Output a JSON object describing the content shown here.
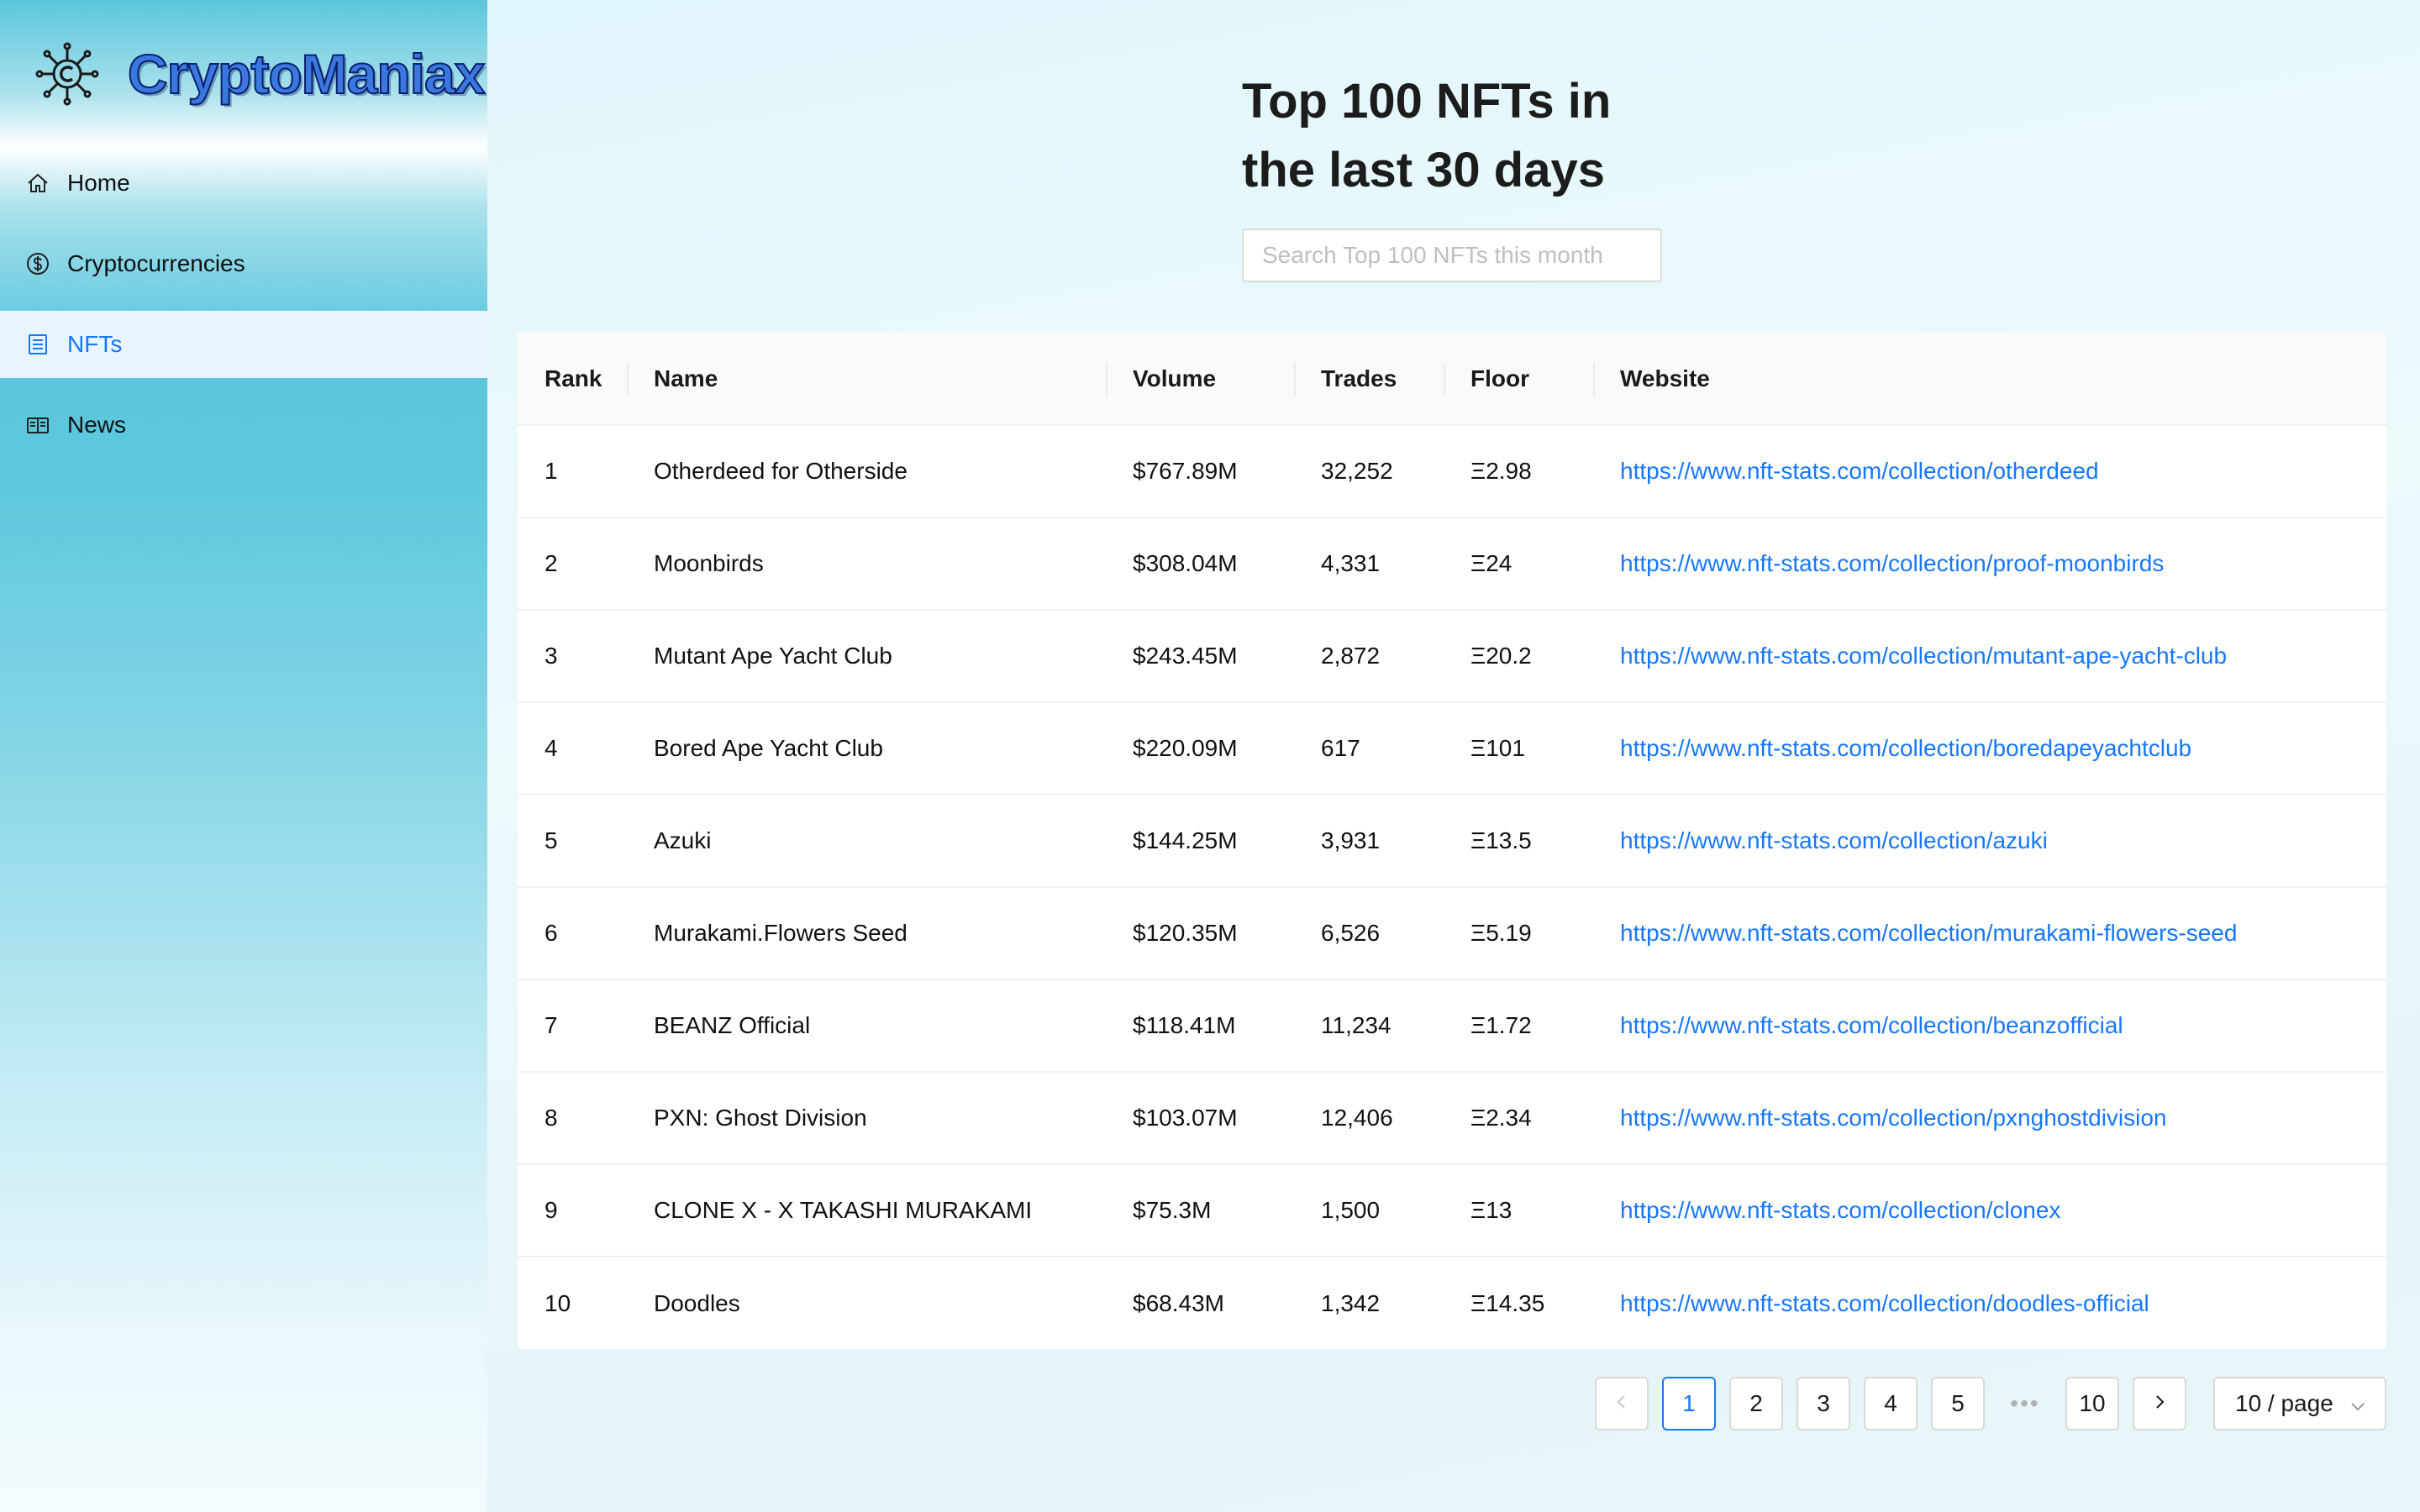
{
  "brand": {
    "name": "CryptoManiax",
    "logo_icon": "crypto-network-icon"
  },
  "sidebar": {
    "items": [
      {
        "label": "Home",
        "icon": "home-icon",
        "active": false
      },
      {
        "label": "Cryptocurrencies",
        "icon": "dollar-circle-icon",
        "active": false
      },
      {
        "label": "NFTs",
        "icon": "list-icon",
        "active": true
      },
      {
        "label": "News",
        "icon": "book-icon",
        "active": false
      }
    ]
  },
  "main": {
    "title_line1": "Top 100 NFTs in",
    "title_line2": "the last 30 days",
    "search_placeholder": "Search Top 100 NFTs this month",
    "search_value": ""
  },
  "table": {
    "columns": [
      "Rank",
      "Name",
      "Volume",
      "Trades",
      "Floor",
      "Website"
    ],
    "rows": [
      {
        "rank": "1",
        "name": "Otherdeed for Otherside",
        "volume": "$767.89M",
        "trades": "32,252",
        "floor": "Ξ2.98",
        "website": "https://www.nft-stats.com/collection/otherdeed"
      },
      {
        "rank": "2",
        "name": "Moonbirds",
        "volume": "$308.04M",
        "trades": "4,331",
        "floor": "Ξ24",
        "website": "https://www.nft-stats.com/collection/proof-moonbirds"
      },
      {
        "rank": "3",
        "name": "Mutant Ape Yacht Club",
        "volume": "$243.45M",
        "trades": "2,872",
        "floor": "Ξ20.2",
        "website": "https://www.nft-stats.com/collection/mutant-ape-yacht-club"
      },
      {
        "rank": "4",
        "name": "Bored Ape Yacht Club",
        "volume": "$220.09M",
        "trades": "617",
        "floor": "Ξ101",
        "website": "https://www.nft-stats.com/collection/boredapeyachtclub"
      },
      {
        "rank": "5",
        "name": "Azuki",
        "volume": "$144.25M",
        "trades": "3,931",
        "floor": "Ξ13.5",
        "website": "https://www.nft-stats.com/collection/azuki"
      },
      {
        "rank": "6",
        "name": "Murakami.Flowers Seed",
        "volume": "$120.35M",
        "trades": "6,526",
        "floor": "Ξ5.19",
        "website": "https://www.nft-stats.com/collection/murakami-flowers-seed"
      },
      {
        "rank": "7",
        "name": "BEANZ Official",
        "volume": "$118.41M",
        "trades": "11,234",
        "floor": "Ξ1.72",
        "website": "https://www.nft-stats.com/collection/beanzofficial"
      },
      {
        "rank": "8",
        "name": "PXN: Ghost Division",
        "volume": "$103.07M",
        "trades": "12,406",
        "floor": "Ξ2.34",
        "website": "https://www.nft-stats.com/collection/pxnghostdivision"
      },
      {
        "rank": "9",
        "name": "CLONE X - X TAKASHI MURAKAMI",
        "volume": "$75.3M",
        "trades": "1,500",
        "floor": "Ξ13",
        "website": "https://www.nft-stats.com/collection/clonex"
      },
      {
        "rank": "10",
        "name": "Doodles",
        "volume": "$68.43M",
        "trades": "1,342",
        "floor": "Ξ14.35",
        "website": "https://www.nft-stats.com/collection/doodles-official"
      }
    ]
  },
  "pagination": {
    "prev_icon": "chevron-left-icon",
    "next_icon": "chevron-right-icon",
    "pages": [
      "1",
      "2",
      "3",
      "4",
      "5"
    ],
    "ellipsis": "•••",
    "last_page": "10",
    "current": "1",
    "page_size_label": "10 / page"
  },
  "colors": {
    "accent": "#1677ff",
    "sidebar_cyan": "#5bc6dc",
    "active_bg": "#e8f5fd"
  }
}
